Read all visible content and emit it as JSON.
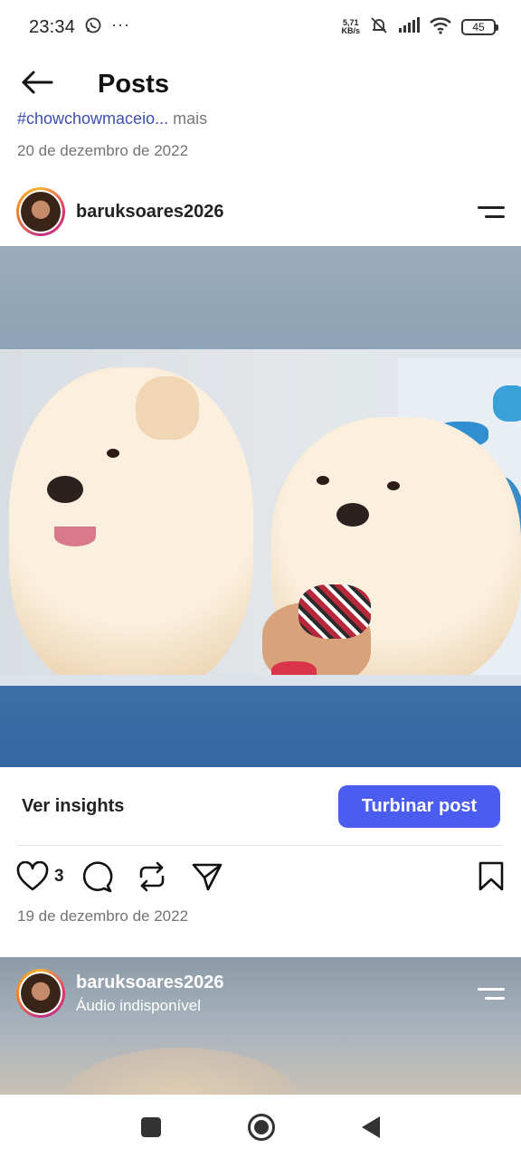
{
  "status_bar": {
    "time": "23:34",
    "whatsapp_icon": "whatsapp-icon",
    "more_dots": "···",
    "net_speed_value": "5,71",
    "net_speed_unit": "KB/s",
    "battery": "45"
  },
  "header": {
    "back_icon": "arrow-left-icon",
    "title": "Posts"
  },
  "previous_post": {
    "caption_fragment": "#chowchowmaceio...",
    "caption_more": "mais",
    "date": "20 de dezembro de 2022"
  },
  "post": {
    "username": "baruksoares2026",
    "insights_label": "Ver insights",
    "boost_label": "Turbinar post",
    "like_count": "3",
    "date": "19 de dezembro de 2022",
    "accent_color": "#4a5df0"
  },
  "next_post": {
    "username": "baruksoares2026",
    "audio_label": "Áudio indisponível"
  }
}
